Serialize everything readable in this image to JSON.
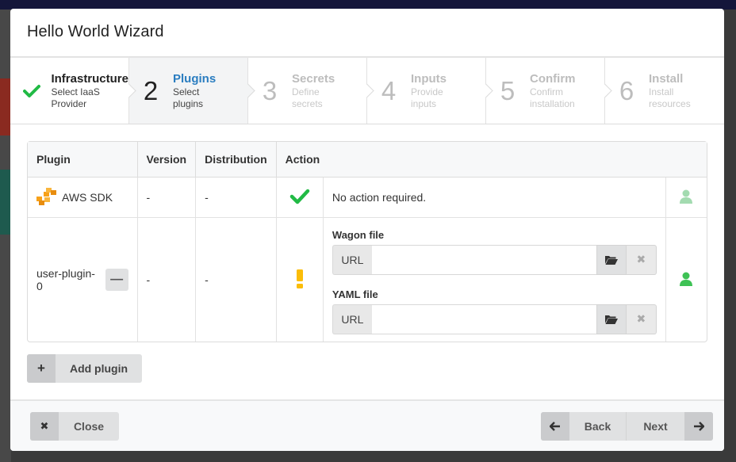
{
  "modal": {
    "title": "Hello World Wizard"
  },
  "steps": [
    {
      "num": "",
      "title": "Infrastructure",
      "desc1": "Select IaaS",
      "desc2": "Provider",
      "state": "completed"
    },
    {
      "num": "2",
      "title": "Plugins",
      "desc1": "Select",
      "desc2": "plugins",
      "state": "active"
    },
    {
      "num": "3",
      "title": "Secrets",
      "desc1": "Define",
      "desc2": "secrets",
      "state": "disabled"
    },
    {
      "num": "4",
      "title": "Inputs",
      "desc1": "Provide",
      "desc2": "inputs",
      "state": "disabled"
    },
    {
      "num": "5",
      "title": "Confirm",
      "desc1": "Confirm",
      "desc2": "installation",
      "state": "disabled"
    },
    {
      "num": "6",
      "title": "Install",
      "desc1": "Install",
      "desc2": "resources",
      "state": "disabled"
    }
  ],
  "table": {
    "headers": [
      "Plugin",
      "Version",
      "Distribution",
      "Action"
    ],
    "rows": [
      {
        "plugin": "AWS SDK",
        "version": "-",
        "distribution": "-",
        "action_text": "No action required."
      },
      {
        "plugin": "user-plugin-0",
        "version": "-",
        "distribution": "-"
      }
    ],
    "wagon_label": "Wagon file",
    "yaml_label": "YAML file",
    "url_label": "URL"
  },
  "buttons": {
    "add_plugin": "Add plugin",
    "close": "Close",
    "back": "Back",
    "next": "Next"
  },
  "colors": {
    "accent": "#2a7dc0",
    "success": "#21ba45",
    "warning": "#fbbd08",
    "user_icon_light": "#a3dbb0",
    "user_icon": "#3ec255"
  }
}
